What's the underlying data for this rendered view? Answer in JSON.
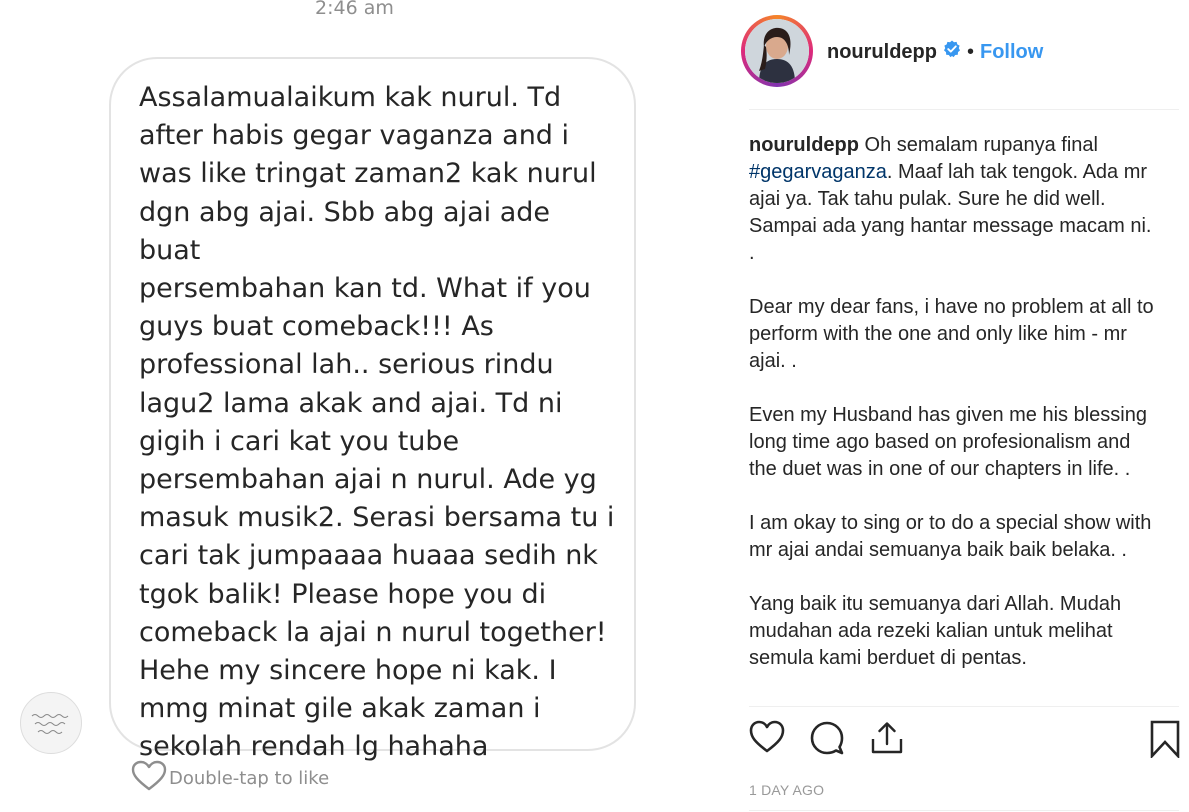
{
  "message": {
    "timestamp": "2:46 am",
    "text": "Assalamualaikum kak nurul. Td\nafter habis gegar vaganza and i\nwas like tringat zaman2 kak nurul\ndgn abg ajai. Sbb abg ajai ade buat\npersembahan kan td. What if you\nguys buat comeback!!! As\nprofessional lah.. serious rindu\nlagu2 lama akak and ajai. Td ni\ngigih i cari kat you tube\npersembahan ajai n nurul. Ade yg\nmasuk musik2. Serasi bersama tu i\ncari tak jumpaaaa huaaa sedih nk\ntgok balik! Please hope you di\ncomeback la ajai n nurul together!\nHehe my sincere hope ni kak. I\nmmg minat gile akak zaman i\nsekolah rendah lg hahaha",
    "like_hint": "Double-tap to like",
    "sender_avatar_icon": "handwritten-logo-avatar-icon"
  },
  "post": {
    "username": "nouruldepp",
    "verified_icon": "verified-badge-icon",
    "separator": "•",
    "follow_label": "Follow",
    "caption": {
      "username": "nouruldepp",
      "intro": "Oh semalam rupanya final",
      "hashtag": "#gegarvaganza",
      "intro_rest": ". Maaf lah tak tengok. Ada mr ajai ya. Tak tahu pulak. Sure he did well. Sampai ada yang hantar message macam ni. .",
      "p2": "Dear my dear fans, i have no problem at all to perform with the one and only like him - mr ajai. .",
      "p3": "Even my Husband has given me his blessing long time ago based on profesionalism and the duet was in one of our chapters in life. .",
      "p4": "I am okay to sing or to do a special show with mr ajai andai semuanya baik baik belaka. .",
      "p5": "Yang baik itu semuanya dari Allah. Mudah mudahan ada rezeki kalian untuk melihat semula kami berduet di pentas."
    },
    "actions": [
      "like-icon",
      "comment-icon",
      "share-icon",
      "bookmark-icon"
    ],
    "date": "1 DAY AGO",
    "colors": {
      "follow": "#3897f0",
      "verified": "#3897f0",
      "hashtag": "#003569"
    }
  }
}
